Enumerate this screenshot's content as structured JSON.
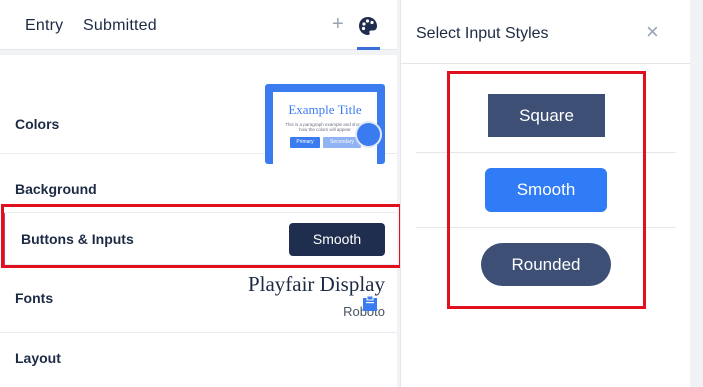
{
  "tabs": {
    "entry": "Entry",
    "submitted": "Submitted",
    "active": "palette"
  },
  "settings": {
    "colors_label": "Colors",
    "preview": {
      "title": "Example Title",
      "paragraph": "This is a paragraph example and shows how the colors will appear",
      "primary_label": "Primary",
      "secondary_label": "Secondary"
    },
    "background_label": "Background",
    "background_color": "#3a7cf0",
    "buttons_label": "Buttons & Inputs",
    "buttons_value": "Smooth",
    "fonts_label": "Fonts",
    "font_primary": "Playfair Display",
    "font_secondary": "Roboto",
    "layout_label": "Layout"
  },
  "panel": {
    "title": "Select Input Styles",
    "options": [
      "Square",
      "Smooth",
      "Rounded"
    ],
    "selected": "Smooth"
  },
  "colors": {
    "accent": "#3a7cf0",
    "dark": "#1f2d4f",
    "highlight": "#e0101e"
  }
}
